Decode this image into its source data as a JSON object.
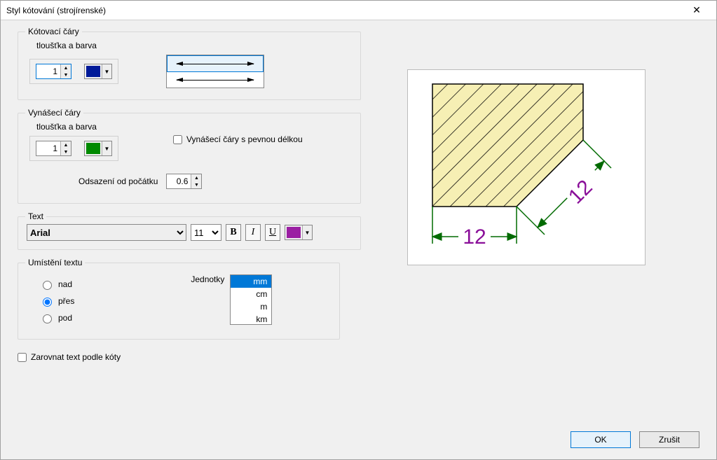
{
  "window": {
    "title": "Styl kótování (strojírenské)"
  },
  "dimLines": {
    "legend": "Kótovací čáry",
    "thicknessLabel": "tloušťka a barva",
    "thickness": "1",
    "colorHex": "#001a99"
  },
  "extLines": {
    "legend": "Vynášecí čáry",
    "thicknessLabel": "tloušťka a barva",
    "thickness": "1",
    "colorHex": "#008a00",
    "fixedLengthLabel": "Vynášecí čáry s pevnou délkou",
    "fixedLengthChecked": false,
    "offsetLabel": "Odsazení od počátku",
    "offsetValue": "0.6"
  },
  "text": {
    "legend": "Text",
    "font": "Arial",
    "size": "11",
    "colorHex": "#9b1fa3",
    "bold": "B",
    "italic": "I",
    "underline": "U"
  },
  "placement": {
    "legend": "Umístění textu",
    "options": {
      "above": "nad",
      "through": "přes",
      "below": "pod"
    },
    "selected": "through",
    "unitsLabel": "Jednotky",
    "units": [
      "mm",
      "cm",
      "m",
      "km"
    ],
    "unitsSelected": "mm"
  },
  "alignLabel": "Zarovnat text podle kóty",
  "alignChecked": false,
  "buttons": {
    "ok": "OK",
    "cancel": "Zrušit"
  },
  "previewDims": {
    "horizontal": "12",
    "diagonal": "12"
  }
}
